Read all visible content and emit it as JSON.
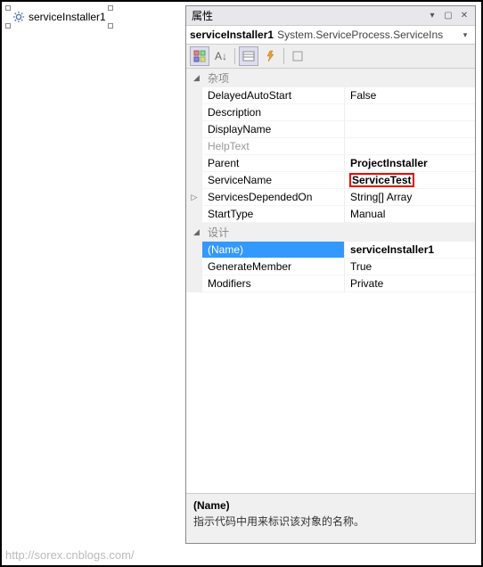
{
  "designer": {
    "component_label": "serviceInstaller1"
  },
  "panel": {
    "title": "属性",
    "object_name": "serviceInstaller1",
    "object_type": "System.ServiceProcess.ServiceIns"
  },
  "categories": {
    "misc": "杂项",
    "design": "设计"
  },
  "props": {
    "DelayedAutoStart": {
      "name": "DelayedAutoStart",
      "value": "False"
    },
    "Description": {
      "name": "Description",
      "value": ""
    },
    "DisplayName": {
      "name": "DisplayName",
      "value": ""
    },
    "HelpText": {
      "name": "HelpText",
      "value": ""
    },
    "Parent": {
      "name": "Parent",
      "value": "ProjectInstaller"
    },
    "ServiceName": {
      "name": "ServiceName",
      "value": "ServiceTest"
    },
    "ServicesDependedOn": {
      "name": "ServicesDependedOn",
      "value": "String[] Array"
    },
    "StartType": {
      "name": "StartType",
      "value": "Manual"
    },
    "Name": {
      "name": "(Name)",
      "value": "serviceInstaller1"
    },
    "GenerateMember": {
      "name": "GenerateMember",
      "value": "True"
    },
    "Modifiers": {
      "name": "Modifiers",
      "value": "Private"
    }
  },
  "description": {
    "title": "(Name)",
    "body": "指示代码中用来标识该对象的名称。"
  },
  "watermark": "http://sorex.cnblogs.com/"
}
